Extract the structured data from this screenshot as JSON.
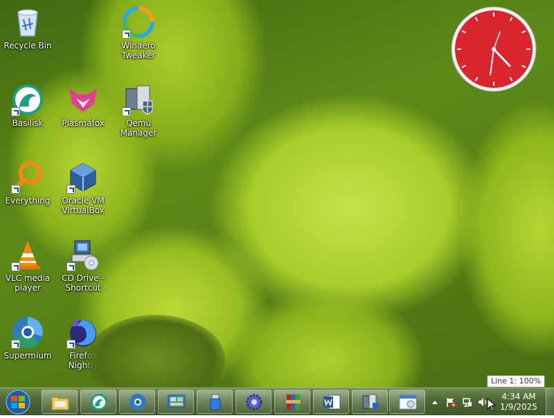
{
  "desktop_icons": [
    {
      "label": "Recycle Bin",
      "icon": "recycle-bin-icon"
    },
    {
      "label": "Winaero\nTweaker",
      "icon": "winaero-tweaker-icon"
    },
    {
      "label": "Basilisk",
      "icon": "basilisk-icon"
    },
    {
      "label": "Plasmafox",
      "icon": "plasmafox-icon"
    },
    {
      "label": "Qemu\nManager",
      "icon": "qemu-manager-icon"
    },
    {
      "label": "Everything",
      "icon": "everything-icon"
    },
    {
      "label": "Oracle VM\nVirtualBox",
      "icon": "virtualbox-icon"
    },
    {
      "label": "VLC media\nplayer",
      "icon": "vlc-icon"
    },
    {
      "label": "CD Drive -\nShortcut",
      "icon": "cd-drive-icon"
    },
    {
      "label": "Supermium",
      "icon": "supermium-icon"
    },
    {
      "label": "Firefox\nNightly",
      "icon": "firefox-nightly-icon"
    }
  ],
  "taskbar": {
    "start_icon": "windows-start-icon",
    "pinned": [
      {
        "icon": "file-explorer-icon"
      },
      {
        "icon": "basilisk-icon"
      },
      {
        "icon": "supermium-icon"
      },
      {
        "icon": "control-panel-icon"
      },
      {
        "icon": "usb-drive-icon"
      },
      {
        "icon": "gear-settings-icon"
      },
      {
        "icon": "winrar-icon"
      },
      {
        "icon": "word-icon"
      },
      {
        "icon": "qemu-manager-icon"
      },
      {
        "icon": "window-app-icon"
      }
    ]
  },
  "tray": {
    "time": "4:34 AM",
    "date": "1/9/2025",
    "icons": [
      "show-hidden-icons-chevron",
      "action-center-flag-icon",
      "network-icon",
      "volume-icon"
    ]
  },
  "tooltip": "Line 1: 100%",
  "colors": {
    "clock_face": "#d9262e",
    "accent": "#4c6532"
  }
}
